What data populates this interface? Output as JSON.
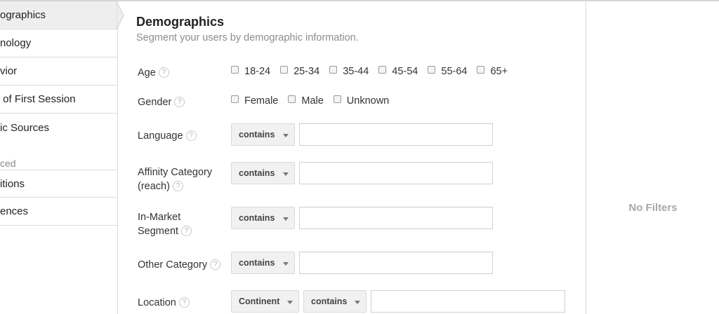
{
  "sidebar": {
    "items": [
      {
        "label": "ographics"
      },
      {
        "label": "nology"
      },
      {
        "label": "vior"
      },
      {
        "label": " of First Session"
      },
      {
        "label": "ic Sources"
      }
    ],
    "section_label": "ced",
    "advanced_items": [
      {
        "label": "itions"
      },
      {
        "label": "ences"
      }
    ]
  },
  "main": {
    "title": "Demographics",
    "subtitle": "Segment your users by demographic information.",
    "help_glyph": "?",
    "age": {
      "label": "Age",
      "options": [
        "18-24",
        "25-34",
        "35-44",
        "45-54",
        "55-64",
        "65+"
      ]
    },
    "gender": {
      "label": "Gender",
      "options": [
        "Female",
        "Male",
        "Unknown"
      ]
    },
    "language": {
      "label": "Language",
      "operator": "contains",
      "value": ""
    },
    "affinity": {
      "label_line1": "Affinity Category",
      "label_line2": "(reach)",
      "operator": "contains",
      "value": ""
    },
    "in_market": {
      "label_line1": "In-Market",
      "label_line2": "Segment",
      "operator": "contains",
      "value": ""
    },
    "other_category": {
      "label": "Other Category",
      "operator": "contains",
      "value": ""
    },
    "location": {
      "label": "Location",
      "scope": "Continent",
      "operator": "contains",
      "value": ""
    }
  },
  "right_panel": {
    "empty_text": "No Filters"
  },
  "colors": {
    "border": "#dcdcdc",
    "active_bg": "#eeeeee",
    "muted_text": "#8c8c8c",
    "dropdown_bg": "#f1f1f1"
  }
}
